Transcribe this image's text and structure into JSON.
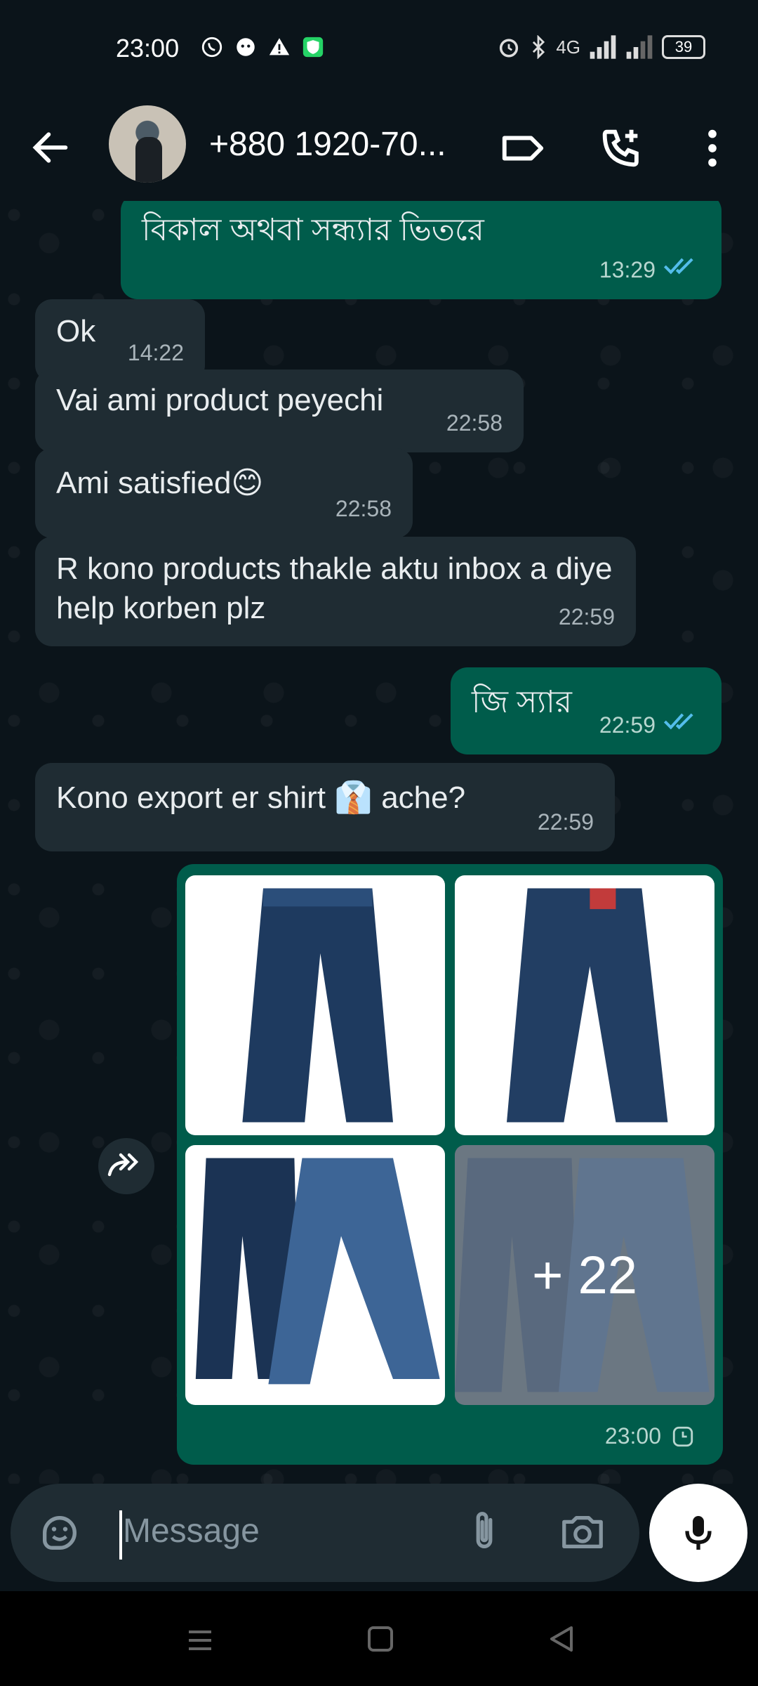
{
  "status_bar": {
    "time": "23:00",
    "battery": "39",
    "icons_left": [
      "whatsapp-call-icon",
      "app-notification-icon",
      "warning-icon",
      "shield-icon"
    ],
    "icons_right": [
      "alarm-icon",
      "bluetooth-icon",
      "signal-4g-icon",
      "signal-icon",
      "battery-icon"
    ],
    "network_label": "4G"
  },
  "header": {
    "contact_name": "+880 1920-70...",
    "icons": [
      "back-arrow-icon",
      "label-icon",
      "add-call-icon",
      "more-vert-icon"
    ]
  },
  "messages": [
    {
      "direction": "out",
      "text": "বিকাল অথবা সন্ধ্যার ভিতরে",
      "time": "13:29",
      "status": "read"
    },
    {
      "direction": "in",
      "text": "Ok",
      "time": "14:22"
    },
    {
      "direction": "in",
      "text": "Vai ami product peyechi",
      "time": "22:58"
    },
    {
      "direction": "in",
      "text": "Ami satisfied😊",
      "time": "22:58"
    },
    {
      "direction": "in",
      "text": "R kono products thakle aktu inbox a diye help korben plz",
      "time": "22:59"
    },
    {
      "direction": "out",
      "text": "জি স্যার",
      "time": "22:59",
      "status": "read"
    },
    {
      "direction": "in",
      "text": "Kono export er shirt 👔 ache?",
      "time": "22:59"
    }
  ],
  "photo_message": {
    "more_count": "+ 22",
    "time": "23:00",
    "status": "pending"
  },
  "input": {
    "placeholder": "Message",
    "icons": [
      "sticker-icon",
      "attach-icon",
      "camera-icon",
      "mic-icon"
    ]
  },
  "nav": {
    "icons": [
      "recents-icon",
      "home-icon",
      "back-icon"
    ]
  },
  "colors": {
    "background": "#0b141a",
    "incoming_bubble": "#1f2c33",
    "outgoing_bubble": "#005c4b",
    "read_tick": "#53bdeb"
  }
}
